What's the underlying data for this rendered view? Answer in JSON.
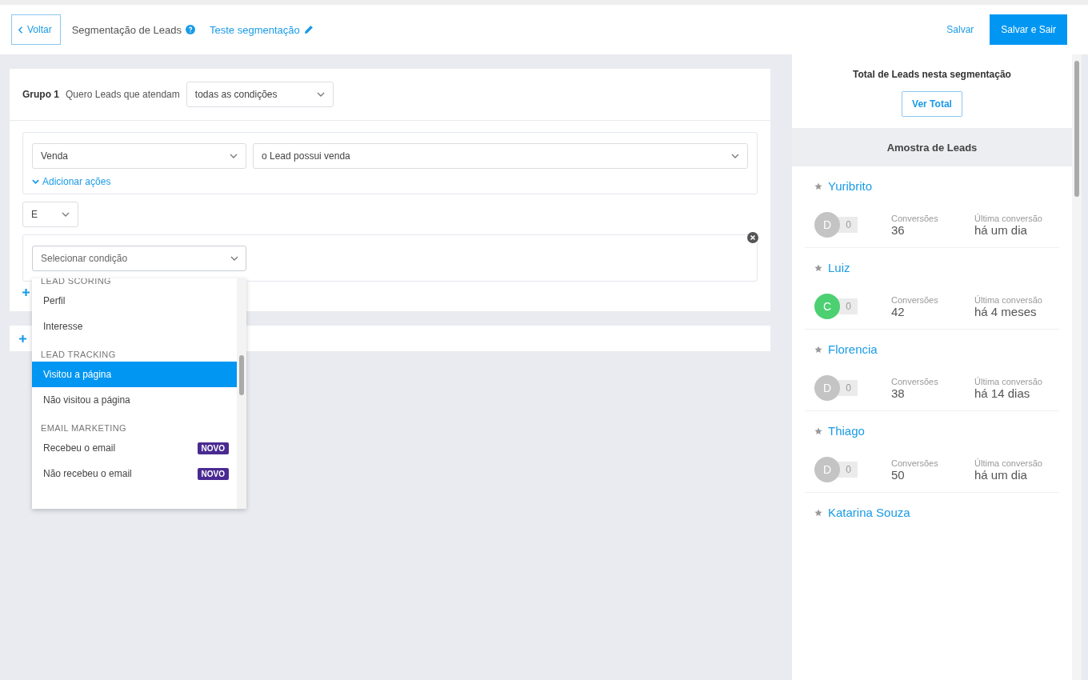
{
  "header": {
    "back": "Voltar",
    "title": "Segmentação de Leads",
    "segment_name": "Teste segmentação",
    "save": "Salvar",
    "save_exit": "Salvar e Sair"
  },
  "group": {
    "label": "Grupo 1",
    "prompt": "Quero Leads que atendam",
    "match": "todas as condições",
    "conditions": [
      {
        "field": "Venda",
        "operator": "o Lead possui venda",
        "actions_link": "Adicionar ações"
      }
    ],
    "connector": "E",
    "new_condition": {
      "placeholder": "Selecionar condição"
    }
  },
  "dropdown": {
    "sections": [
      {
        "heading": "LEAD SCORING",
        "items": [
          {
            "label": "Perfil",
            "selected": false
          },
          {
            "label": "Interesse",
            "selected": false
          }
        ]
      },
      {
        "heading": "LEAD TRACKING",
        "items": [
          {
            "label": "Visitou a página",
            "selected": true
          },
          {
            "label": "Não visitou a página",
            "selected": false
          }
        ]
      },
      {
        "heading": "EMAIL MARKETING",
        "items": [
          {
            "label": "Recebeu o email",
            "selected": false,
            "badge": "NOVO"
          },
          {
            "label": "Não recebeu o email",
            "selected": false,
            "badge": "NOVO"
          }
        ]
      }
    ]
  },
  "panel": {
    "total_title": "Total de Leads nesta segmentação",
    "total_button": "Ver Total",
    "sample_title": "Amostra de Leads",
    "leads": [
      {
        "name": "Yuribrito",
        "avatar": "D",
        "color": "#c4c4c4",
        "score": "0",
        "conversions_label": "Conversões",
        "conversions": "36",
        "last_label": "Última conversão",
        "last": "há um dia"
      },
      {
        "name": "Luiz",
        "avatar": "C",
        "color": "#4cd072",
        "score": "0",
        "conversions_label": "Conversões",
        "conversions": "42",
        "last_label": "Última conversão",
        "last": "há 4 meses"
      },
      {
        "name": "Florencia",
        "avatar": "D",
        "color": "#c4c4c4",
        "score": "0",
        "conversions_label": "Conversões",
        "conversions": "38",
        "last_label": "Última conversão",
        "last": "há 14 dias"
      },
      {
        "name": "Thiago",
        "avatar": "D",
        "color": "#c4c4c4",
        "score": "0",
        "conversions_label": "Conversões",
        "conversions": "50",
        "last_label": "Última conversão",
        "last": "há um dia"
      },
      {
        "name": "Katarina Souza"
      }
    ]
  }
}
